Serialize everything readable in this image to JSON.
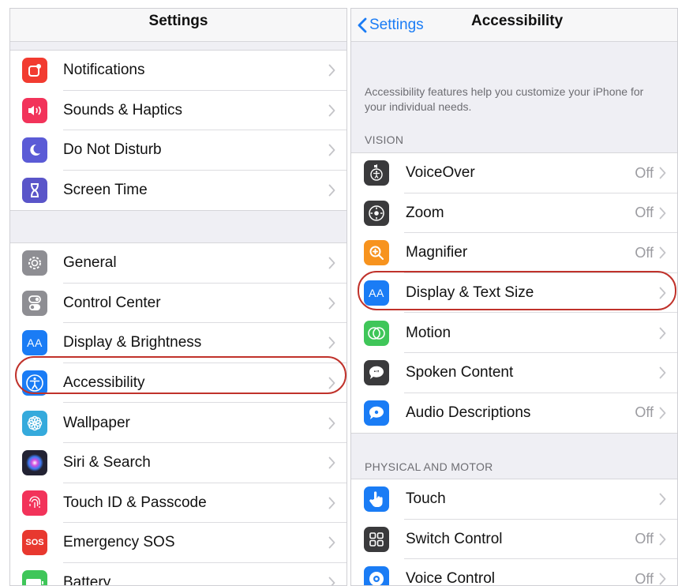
{
  "left": {
    "title": "Settings",
    "group1": [
      {
        "label": "Notifications",
        "icon": "notifications-icon",
        "color": "#f23b30"
      },
      {
        "label": "Sounds & Haptics",
        "icon": "speaker-icon",
        "color": "#f2335a"
      },
      {
        "label": "Do Not Disturb",
        "icon": "moon-icon",
        "color": "#5b5bd6"
      },
      {
        "label": "Screen Time",
        "icon": "hourglass-icon",
        "color": "#5a55c9"
      }
    ],
    "group2": [
      {
        "label": "General",
        "icon": "gear-icon",
        "color": "#8e8e93"
      },
      {
        "label": "Control Center",
        "icon": "toggles-icon",
        "color": "#8e8e93"
      },
      {
        "label": "Display & Brightness",
        "icon": "aa-icon",
        "color": "#1a7cf5"
      },
      {
        "label": "Accessibility",
        "icon": "accessibility-icon",
        "color": "#1a7cf5"
      },
      {
        "label": "Wallpaper",
        "icon": "flower-icon",
        "color": "#35aadc"
      },
      {
        "label": "Siri & Search",
        "icon": "siri-icon",
        "color": "#222233"
      },
      {
        "label": "Touch ID & Passcode",
        "icon": "fingerprint-icon",
        "color": "#f2335a"
      },
      {
        "label": "Emergency SOS",
        "icon": "sos-icon",
        "color": "#e8382f"
      },
      {
        "label": "Battery",
        "icon": "battery-icon",
        "color": "#3fc659"
      }
    ]
  },
  "right": {
    "back_label": "Settings",
    "title": "Accessibility",
    "description": "Accessibility features help you customize your iPhone for your individual needs.",
    "vision_header": "VISION",
    "vision": [
      {
        "label": "VoiceOver",
        "value": "Off",
        "icon": "voiceover-icon",
        "color": "#3a3a3c"
      },
      {
        "label": "Zoom",
        "value": "Off",
        "icon": "zoom-icon",
        "color": "#3a3a3c"
      },
      {
        "label": "Magnifier",
        "value": "Off",
        "icon": "magnifier-icon",
        "color": "#f7931e"
      },
      {
        "label": "Display & Text Size",
        "value": "",
        "icon": "aa-icon",
        "color": "#1a7cf5"
      },
      {
        "label": "Motion",
        "value": "",
        "icon": "motion-icon",
        "color": "#3fc659"
      },
      {
        "label": "Spoken Content",
        "value": "",
        "icon": "speech-bubble-icon",
        "color": "#3a3a3c"
      },
      {
        "label": "Audio Descriptions",
        "value": "Off",
        "icon": "audio-description-icon",
        "color": "#1a7cf5"
      }
    ],
    "physical_header": "PHYSICAL AND MOTOR",
    "physical": [
      {
        "label": "Touch",
        "value": "",
        "icon": "hand-icon",
        "color": "#1a7cf5"
      },
      {
        "label": "Switch Control",
        "value": "Off",
        "icon": "grid-icon",
        "color": "#3a3a3c"
      },
      {
        "label": "Voice Control",
        "value": "Off",
        "icon": "voice-control-icon",
        "color": "#1a7cf5"
      }
    ]
  }
}
